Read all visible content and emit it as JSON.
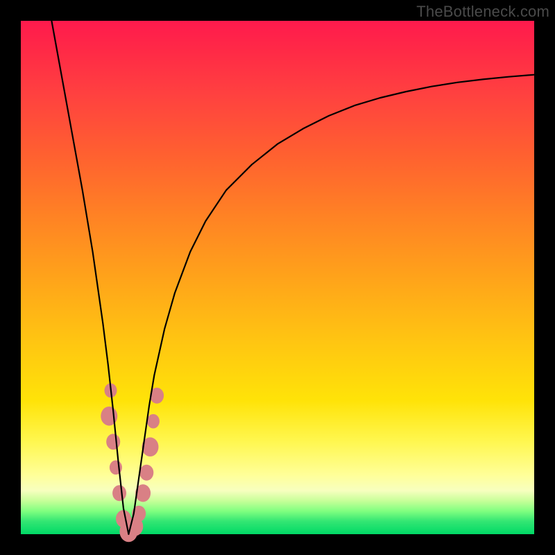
{
  "watermark": "TheBottleneck.com",
  "chart_data": {
    "type": "line",
    "title": "",
    "xlabel": "",
    "ylabel": "",
    "xlim": [
      0,
      100
    ],
    "ylim": [
      0,
      100
    ],
    "series": [
      {
        "name": "curve",
        "x": [
          6,
          8,
          10,
          12,
          14,
          15,
          16,
          17,
          18,
          19,
          20,
          21,
          22,
          23,
          24,
          25,
          26,
          28,
          30,
          33,
          36,
          40,
          45,
          50,
          55,
          60,
          65,
          70,
          75,
          80,
          85,
          90,
          95,
          100
        ],
        "y": [
          100,
          89,
          78,
          67,
          55,
          48,
          41,
          33,
          24,
          14,
          5,
          0,
          4,
          11,
          18,
          25,
          31,
          40,
          47,
          55,
          61,
          67,
          72,
          76,
          79,
          81.5,
          83.5,
          85,
          86.2,
          87.2,
          88,
          88.6,
          89.1,
          89.5
        ]
      }
    ],
    "markers": {
      "name": "points",
      "color": "#d98085",
      "stroke": "#b55a63",
      "radius_range": [
        8,
        14
      ],
      "points": [
        {
          "x": 17.5,
          "y": 28,
          "r": 9
        },
        {
          "x": 17.2,
          "y": 23,
          "r": 12
        },
        {
          "x": 18.0,
          "y": 18,
          "r": 10
        },
        {
          "x": 18.5,
          "y": 13,
          "r": 9
        },
        {
          "x": 19.2,
          "y": 8,
          "r": 10
        },
        {
          "x": 20.0,
          "y": 3,
          "r": 11
        },
        {
          "x": 21.0,
          "y": 0.5,
          "r": 13
        },
        {
          "x": 22.2,
          "y": 1.5,
          "r": 12
        },
        {
          "x": 23.0,
          "y": 4,
          "r": 10
        },
        {
          "x": 23.8,
          "y": 8,
          "r": 11
        },
        {
          "x": 24.5,
          "y": 12,
          "r": 10
        },
        {
          "x": 25.2,
          "y": 17,
          "r": 12
        },
        {
          "x": 25.8,
          "y": 22,
          "r": 9
        },
        {
          "x": 26.5,
          "y": 27,
          "r": 10
        }
      ]
    },
    "background_gradient": {
      "top": "#ff1a4d",
      "upper_mid": "#ff8020",
      "mid": "#ffd010",
      "lower_mid": "#ffff90",
      "bottom": "#00d966"
    }
  }
}
